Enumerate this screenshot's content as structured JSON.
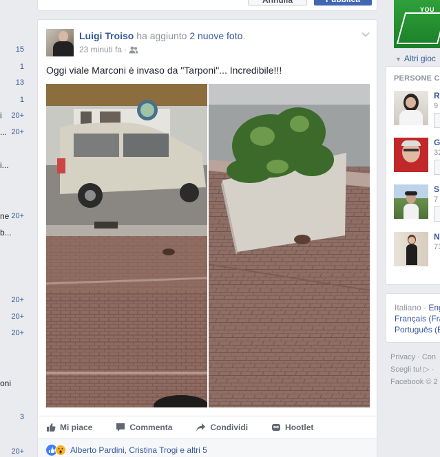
{
  "left_column": {
    "counts": [
      "15",
      "1",
      "13",
      "1",
      "20+",
      "20+",
      "20+",
      "20+",
      "20+",
      "20+",
      "3",
      "20+"
    ],
    "fragments": [
      "i",
      "...",
      "i...",
      "ne",
      "b...",
      "oni"
    ]
  },
  "composer": {
    "cancel_label": "Annulla",
    "publish_label": "Pubblica"
  },
  "post": {
    "author": "Luigi Troiso",
    "action_text": " ha aggiunto ",
    "photos_link": "2 nuove foto",
    "period": ".",
    "timestamp": "23 minuti fa",
    "separator": "·",
    "privacy_icon": "friends-icon",
    "text": "Oggi viale Marconi è invaso da \"Tarponi\"... Incredibile!!!",
    "actions": [
      {
        "label": "Mi piace",
        "icon": "thumbs-up-icon"
      },
      {
        "label": "Commenta",
        "icon": "comment-icon"
      },
      {
        "label": "Condividi",
        "icon": "share-icon"
      },
      {
        "label": "Hootlet",
        "icon": "hootlet-icon"
      }
    ],
    "likes_text": "Alberto Pardini, Cristina Trogi e altri 5"
  },
  "right_column": {
    "game_banner_text": "YOU",
    "other_games": "Altri gioc",
    "people_title": "PERSONE CI",
    "people": [
      {
        "initial": "R",
        "sub": "9"
      },
      {
        "initial": "G",
        "sub": "32"
      },
      {
        "initial": "S",
        "sub": "7"
      },
      {
        "initial": "N",
        "sub": "73"
      }
    ],
    "languages": {
      "current": "Italiano",
      "separator": " · ",
      "others": [
        "Engl",
        "Français (Fra",
        "Português (B"
      ]
    },
    "footer": [
      "Privacy · Con",
      "Scegli tu! ▷ ·",
      "Facebook © 2"
    ]
  },
  "colors": {
    "link": "#365899",
    "brand": "#4267b2",
    "meta": "#90949c",
    "text": "#1d2129",
    "background": "#e9ebee"
  }
}
